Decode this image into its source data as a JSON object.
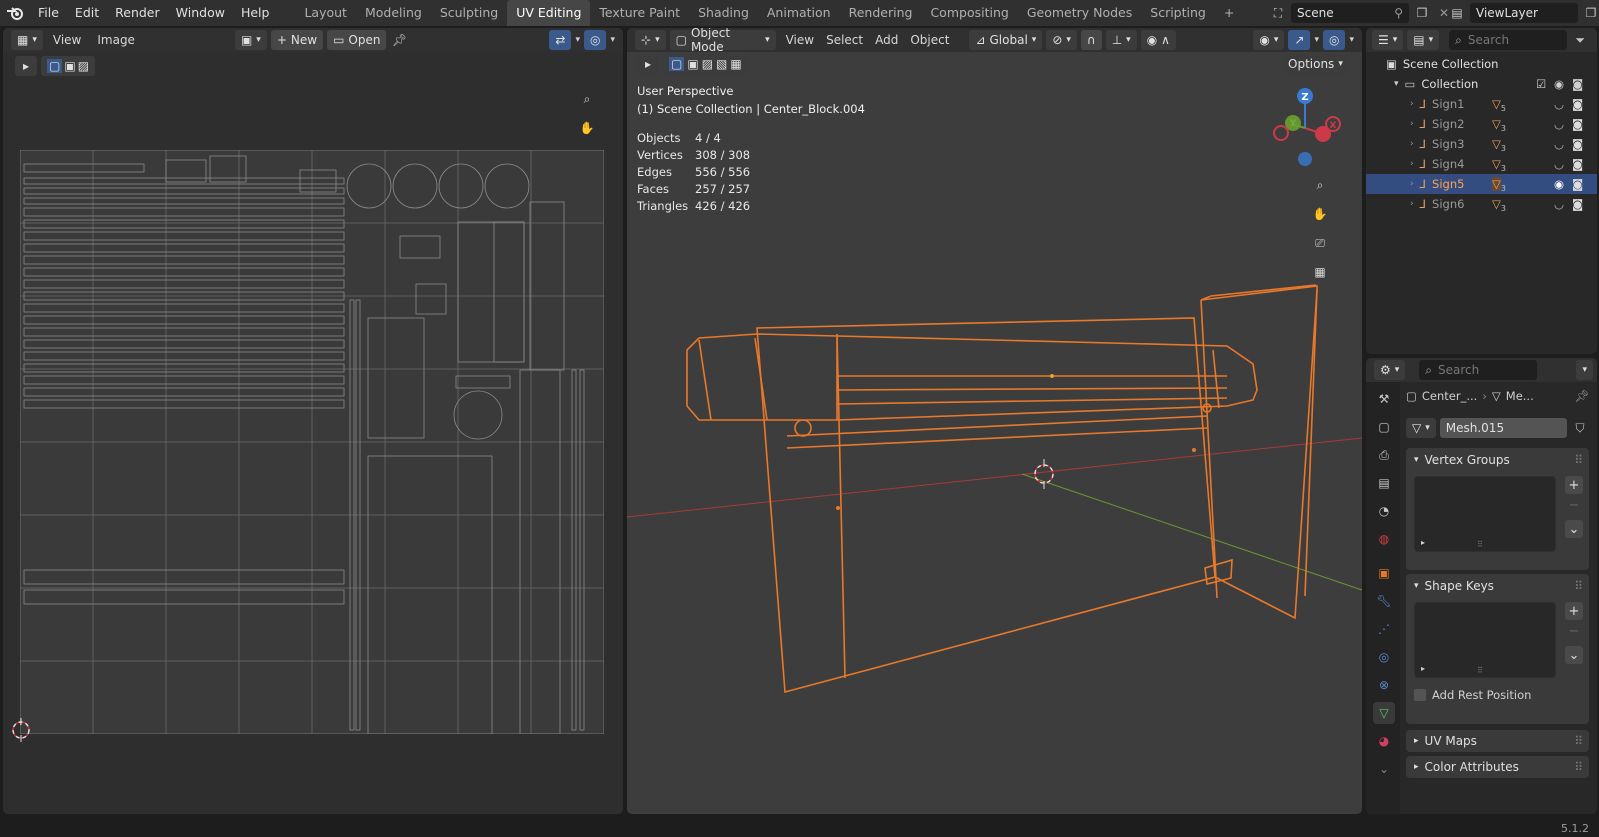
{
  "menu": {
    "items": [
      "File",
      "Edit",
      "Render",
      "Window",
      "Help"
    ]
  },
  "workspaces": {
    "tabs": [
      "Layout",
      "Modeling",
      "Sculpting",
      "UV Editing",
      "Texture Paint",
      "Shading",
      "Animation",
      "Rendering",
      "Compositing",
      "Geometry Nodes",
      "Scripting"
    ],
    "active": "UV Editing"
  },
  "scene": {
    "name": "Scene",
    "view_layer": "ViewLayer"
  },
  "uv_editor": {
    "menu_view": "View",
    "menu_image": "Image",
    "new_label": "New",
    "open_label": "Open"
  },
  "viewport": {
    "mode": "Object Mode",
    "menus": [
      "View",
      "Select",
      "Add",
      "Object"
    ],
    "orientation": "Global",
    "options_label": "Options",
    "perspective": "User Perspective",
    "context": "(1) Scene Collection | Center_Block.004",
    "stats": [
      {
        "key": "Objects",
        "value": "4 / 4"
      },
      {
        "key": "Vertices",
        "value": "308 / 308"
      },
      {
        "key": "Edges",
        "value": "556 / 556"
      },
      {
        "key": "Faces",
        "value": "257 / 257"
      },
      {
        "key": "Triangles",
        "value": "426 / 426"
      }
    ],
    "gizmo": {
      "x": "X",
      "y": "Y",
      "z": "Z"
    }
  },
  "outliner": {
    "search_placeholder": "Search",
    "scene_collection": "Scene Collection",
    "collection": "Collection",
    "items": [
      {
        "name": "Sign1",
        "count": "5",
        "selected": false
      },
      {
        "name": "Sign2",
        "count": "3",
        "selected": false
      },
      {
        "name": "Sign3",
        "count": "3",
        "selected": false
      },
      {
        "name": "Sign4",
        "count": "3",
        "selected": false
      },
      {
        "name": "Sign5",
        "count": "3",
        "selected": true
      },
      {
        "name": "Sign6",
        "count": "3",
        "selected": false
      }
    ]
  },
  "properties": {
    "search_placeholder": "Search",
    "breadcrumb_object": "Center_...",
    "breadcrumb_mesh": "Me...",
    "mesh_name": "Mesh.015",
    "panels": {
      "vertex_groups": "Vertex Groups",
      "shape_keys": "Shape Keys",
      "add_rest_position": "Add Rest Position",
      "uv_maps": "UV Maps",
      "color_attributes": "Color Attributes"
    }
  },
  "colors": {
    "accent_orange": "#e8782a",
    "selected_blue": "#334d80",
    "active_tab": "#464646"
  },
  "status": {
    "version": "5.1.2"
  }
}
